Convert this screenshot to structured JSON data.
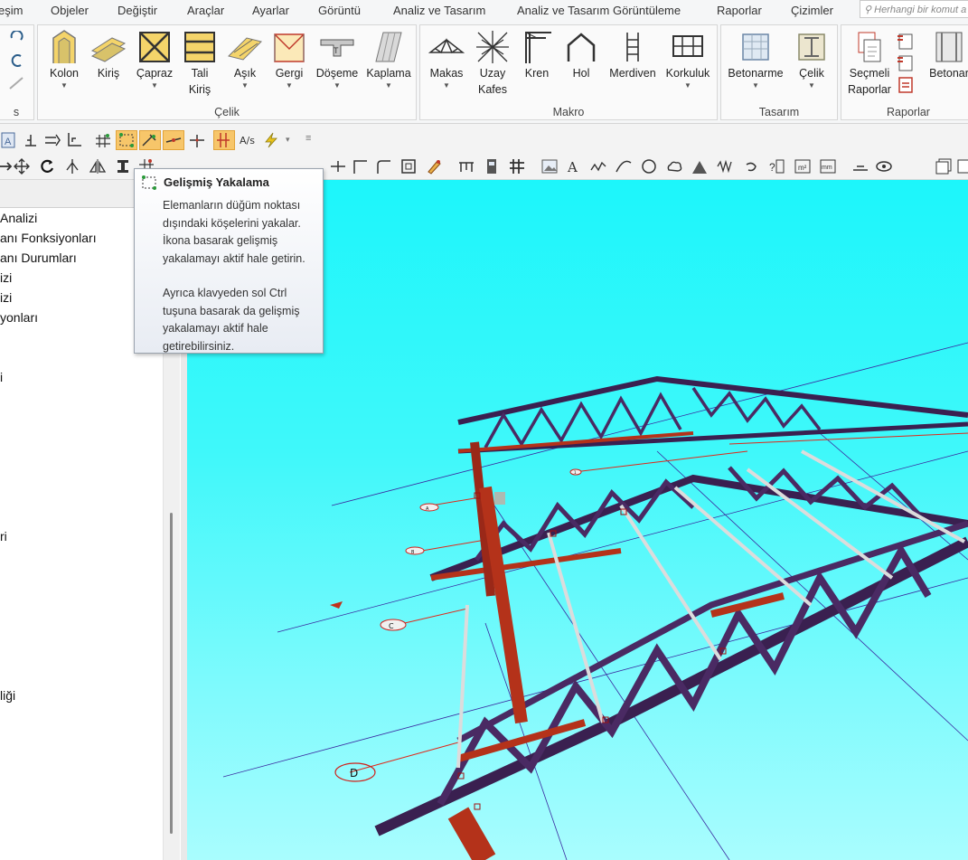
{
  "menu": [
    "eşim",
    "Objeler",
    "Değiştir",
    "Araçlar",
    "Ayarlar",
    "Görüntü",
    "Analiz ve Tasarım",
    "Analiz ve Tasarım Görüntüleme",
    "Raporlar",
    "Çizimler"
  ],
  "search": {
    "placeholder": "Herhangi bir komut a"
  },
  "ribbon": {
    "left_group_label": "s",
    "celik": {
      "label": "Çelik",
      "buttons": [
        {
          "label": "Kolon",
          "icon": "column-icon",
          "dropdown": true
        },
        {
          "label": "Kiriş",
          "icon": "beam-icon",
          "dropdown": false
        },
        {
          "label": "Çapraz",
          "icon": "brace-icon",
          "dropdown": true
        },
        {
          "label": "Tali Kiriş",
          "icon": "secondary-beam-icon",
          "dropdown": true
        },
        {
          "label": "Aşık",
          "icon": "purlin-icon",
          "dropdown": true
        },
        {
          "label": "Gergi",
          "icon": "tie-rod-icon",
          "dropdown": true
        },
        {
          "label": "Döşeme",
          "icon": "slab-icon",
          "dropdown": true
        },
        {
          "label": "Kaplama",
          "icon": "cladding-icon",
          "dropdown": true
        }
      ]
    },
    "makro": {
      "label": "Makro",
      "buttons": [
        {
          "label": "Makas",
          "icon": "truss-icon",
          "dropdown": true
        },
        {
          "label": "Uzay Kafes",
          "icon": "space-frame-icon",
          "dropdown": false
        },
        {
          "label": "Kren",
          "icon": "crane-icon",
          "dropdown": false
        },
        {
          "label": "Hol",
          "icon": "hall-icon",
          "dropdown": false
        },
        {
          "label": "Merdiven",
          "icon": "stair-icon",
          "dropdown": false
        },
        {
          "label": "Korkuluk",
          "icon": "railing-icon",
          "dropdown": true
        }
      ]
    },
    "tasarim": {
      "label": "Tasarım",
      "buttons": [
        {
          "label": "Betonarme",
          "icon": "concrete-design-icon",
          "dropdown": true
        },
        {
          "label": "Çelik",
          "icon": "steel-design-icon",
          "dropdown": true
        }
      ]
    },
    "raporlar": {
      "label": "Raporlar",
      "buttons": [
        {
          "label": "Seçmeli Raporlar",
          "icon": "selective-reports-icon",
          "dropdown": false
        },
        {
          "label": "Betonar",
          "icon": "concrete-report-icon",
          "dropdown": false
        }
      ]
    }
  },
  "toolbar": {
    "snap_tool": "advanced-snap-icon"
  },
  "side_items": [
    "Analizi",
    "anı Fonksiyonları",
    "anı Durumları",
    "izi",
    "izi",
    "yonları",
    "i",
    "ri",
    "liği"
  ],
  "tooltip": {
    "title": "Gelişmiş Yakalama",
    "p1": "Elemanların düğüm noktası dışındaki köşelerini yakalar. İkona basarak gelişmiş yakalamayı aktif hale getirin.",
    "p2": "Ayrıca klavyeden sol Ctrl tuşuna basarak da gelişmiş yakalamayı aktif hale getirebilirsiniz."
  },
  "axes": [
    "A",
    "B",
    "C",
    "D",
    "1"
  ],
  "colors": {
    "viewport_top": "#1cf6fb",
    "viewport_bottom": "#a9fdfe",
    "truss": "#4a2a63",
    "column": "#b4321a",
    "highlight": "#f7c66a"
  }
}
